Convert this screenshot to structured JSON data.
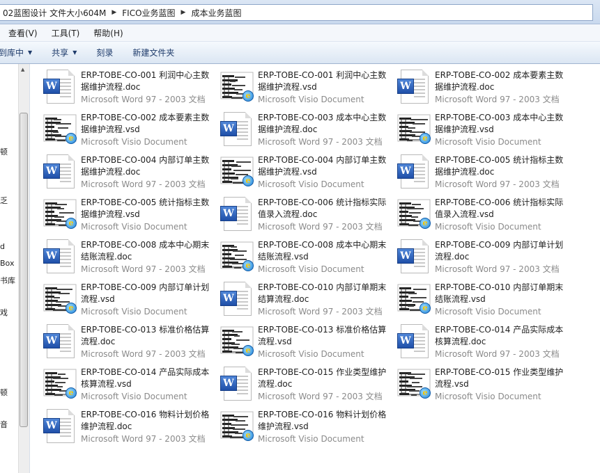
{
  "address": {
    "crumbs": [
      "02蓝图设计 文件大小604M",
      "FICO业务蓝图",
      "成本业务蓝图"
    ]
  },
  "menu": [
    "查看(V)",
    "工具(T)",
    "帮助(H)"
  ],
  "toolbar": {
    "include_library": "含到库中",
    "share": "共享",
    "burn": "刻录",
    "new_folder": "新建文件夹"
  },
  "nav_fragments": [
    "顿",
    "乏",
    "d",
    "Box",
    "书库",
    "戏",
    "顿",
    "音"
  ],
  "type_labels": {
    "word": "Microsoft Word 97 - 2003 文档",
    "visio": "Microsoft Visio Document"
  },
  "files": [
    {
      "name": "ERP-TOBE-CO-001 利润中心主数据维护流程.doc",
      "type": "Microsoft Word 97 - 2003 文档",
      "icon": "word-icon"
    },
    {
      "name": "ERP-TOBE-CO-001 利润中心主数据维护流程.vsd",
      "type": "Microsoft Visio Document",
      "icon": "visio-icon"
    },
    {
      "name": "ERP-TOBE-CO-002 成本要素主数据维护流程.doc",
      "type": "Microsoft Word 97 - 2003 文档",
      "icon": "word-icon"
    },
    {
      "name": "ERP-TOBE-CO-002 成本要素主数据维护流程.vsd",
      "type": "Microsoft Visio Document",
      "icon": "visio-icon"
    },
    {
      "name": "ERP-TOBE-CO-003 成本中心主数据维护流程.doc",
      "type": "Microsoft Word 97 - 2003 文档",
      "icon": "word-icon"
    },
    {
      "name": "ERP-TOBE-CO-003 成本中心主数据维护流程.vsd",
      "type": "Microsoft Visio Document",
      "icon": "visio-icon"
    },
    {
      "name": "ERP-TOBE-CO-004 内部订单主数据维护流程.doc",
      "type": "Microsoft Word 97 - 2003 文档",
      "icon": "word-icon"
    },
    {
      "name": "ERP-TOBE-CO-004 内部订单主数据维护流程.vsd",
      "type": "Microsoft Visio Document",
      "icon": "visio-icon"
    },
    {
      "name": "ERP-TOBE-CO-005 统计指标主数据维护流程.doc",
      "type": "Microsoft Word 97 - 2003 文档",
      "icon": "word-icon"
    },
    {
      "name": "ERP-TOBE-CO-005 统计指标主数据维护流程.vsd",
      "type": "Microsoft Visio Document",
      "icon": "visio-icon"
    },
    {
      "name": "ERP-TOBE-CO-006 统计指标实际值录入流程.doc",
      "type": "Microsoft Word 97 - 2003 文档",
      "icon": "word-icon"
    },
    {
      "name": "ERP-TOBE-CO-006 统计指标实际值录入流程.vsd",
      "type": "Microsoft Visio Document",
      "icon": "visio-icon"
    },
    {
      "name": "ERP-TOBE-CO-008 成本中心期末结账流程.doc",
      "type": "Microsoft Word 97 - 2003 文档",
      "icon": "word-icon"
    },
    {
      "name": "ERP-TOBE-CO-008 成本中心期末结账流程.vsd",
      "type": "Microsoft Visio Document",
      "icon": "visio-icon"
    },
    {
      "name": "ERP-TOBE-CO-009 内部订单计划流程.doc",
      "type": "Microsoft Word 97 - 2003 文档",
      "icon": "word-icon"
    },
    {
      "name": "ERP-TOBE-CO-009 内部订单计划流程.vsd",
      "type": "Microsoft Visio Document",
      "icon": "visio-icon"
    },
    {
      "name": "ERP-TOBE-CO-010 内部订单期末结算流程.doc",
      "type": "Microsoft Word 97 - 2003 文档",
      "icon": "word-icon"
    },
    {
      "name": "ERP-TOBE-CO-010 内部订单期末结账流程.vsd",
      "type": "Microsoft Visio Document",
      "icon": "visio-icon"
    },
    {
      "name": "ERP-TOBE-CO-013 标准价格估算流程.doc",
      "type": "Microsoft Word 97 - 2003 文档",
      "icon": "word-icon"
    },
    {
      "name": "ERP-TOBE-CO-013 标准价格估算流程.vsd",
      "type": "Microsoft Visio Document",
      "icon": "visio-icon"
    },
    {
      "name": "ERP-TOBE-CO-014 产品实际成本核算流程.doc",
      "type": "Microsoft Word 97 - 2003 文档",
      "icon": "word-icon"
    },
    {
      "name": "ERP-TOBE-CO-014 产品实际成本核算流程.vsd",
      "type": "Microsoft Visio Document",
      "icon": "visio-icon"
    },
    {
      "name": "ERP-TOBE-CO-015 作业类型维护流程.doc",
      "type": "Microsoft Word 97 - 2003 文档",
      "icon": "word-icon"
    },
    {
      "name": "ERP-TOBE-CO-015 作业类型维护流程.vsd",
      "type": "Microsoft Visio Document",
      "icon": "visio-icon"
    },
    {
      "name": "ERP-TOBE-CO-016 物料计划价格维护流程.doc",
      "type": "Microsoft Word 97 - 2003 文档",
      "icon": "word-icon"
    },
    {
      "name": "ERP-TOBE-CO-016 物料计划价格维护流程.vsd",
      "type": "Microsoft Visio Document",
      "icon": "visio-icon"
    }
  ]
}
